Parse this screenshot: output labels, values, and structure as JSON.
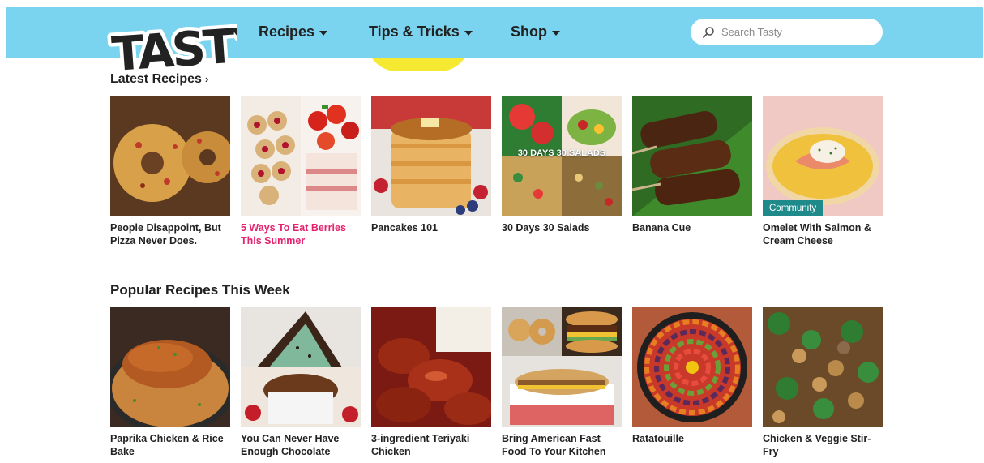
{
  "brand": {
    "logo_text": "TASTY"
  },
  "nav": {
    "items": [
      {
        "label": "Recipes"
      },
      {
        "label": "Tips & Tricks"
      },
      {
        "label": "Shop"
      }
    ]
  },
  "search": {
    "placeholder": "Search Tasty"
  },
  "latest": {
    "title": "Latest Recipes",
    "arrow": "›",
    "cards": [
      {
        "title": "People Disappoint, But Pizza Never Does."
      },
      {
        "title": "5 Ways To Eat Berries This Summer"
      },
      {
        "title": "Pancakes 101"
      },
      {
        "title": "30 Days 30 Salads",
        "overlay": "30 DAYS 30 SALADS"
      },
      {
        "title": "Banana Cue"
      },
      {
        "title": "Omelet With Salmon & Cream Cheese",
        "badge": "Community"
      }
    ]
  },
  "popular": {
    "title": "Popular Recipes This Week",
    "cards": [
      {
        "title": "Paprika Chicken & Rice Bake"
      },
      {
        "title": "You Can Never Have Enough Chocolate"
      },
      {
        "title": "3-ingredient Teriyaki Chicken"
      },
      {
        "title": "Bring American Fast Food To Your Kitchen"
      },
      {
        "title": "Ratatouille"
      },
      {
        "title": "Chicken & Veggie Stir-Fry"
      }
    ]
  },
  "colors": {
    "header_bg": "#7ad4ef",
    "highlight_pink": "#e5226d",
    "badge_teal": "#1f8a8a",
    "accent_yellow": "#f5ea31"
  }
}
